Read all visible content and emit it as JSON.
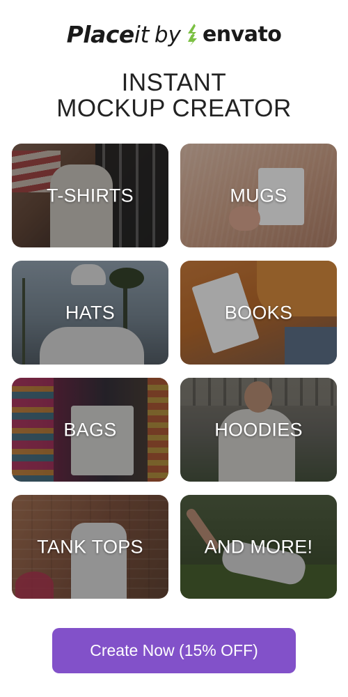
{
  "brand": {
    "name_part1": "Place",
    "name_part2": "it",
    "by": "by",
    "partner": "envato",
    "leaf_color": "#7bc043"
  },
  "headline": {
    "line1": "INSTANT",
    "line2": "MOCKUP CREATOR"
  },
  "tiles": [
    {
      "label": "T-SHIRTS"
    },
    {
      "label": "MUGS"
    },
    {
      "label": "HATS"
    },
    {
      "label": "BOOKS"
    },
    {
      "label": "BAGS"
    },
    {
      "label": "HOODIES"
    },
    {
      "label": "TANK TOPS"
    },
    {
      "label": "AND MORE!"
    }
  ],
  "cta": {
    "label": "Create Now (15% OFF)",
    "color": "#8251c9"
  }
}
